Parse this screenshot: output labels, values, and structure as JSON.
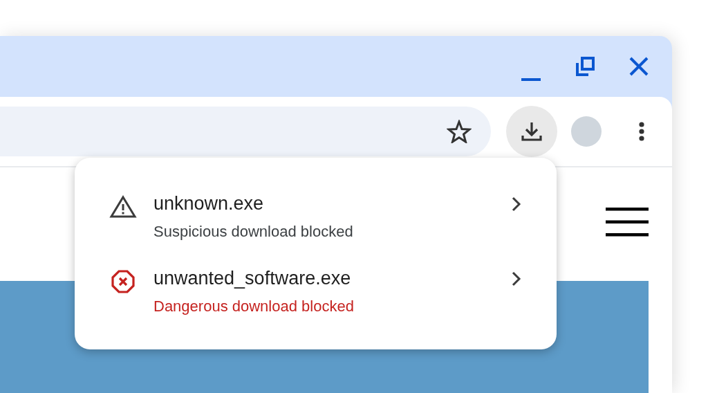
{
  "toolbar": {
    "download_button": {
      "selected": true
    }
  },
  "downloads": [
    {
      "kind": "warning",
      "name": "unknown.exe",
      "status": "Suspicious download blocked"
    },
    {
      "kind": "danger",
      "name": "unwanted_software.exe",
      "status": "Dangerous download blocked"
    }
  ]
}
